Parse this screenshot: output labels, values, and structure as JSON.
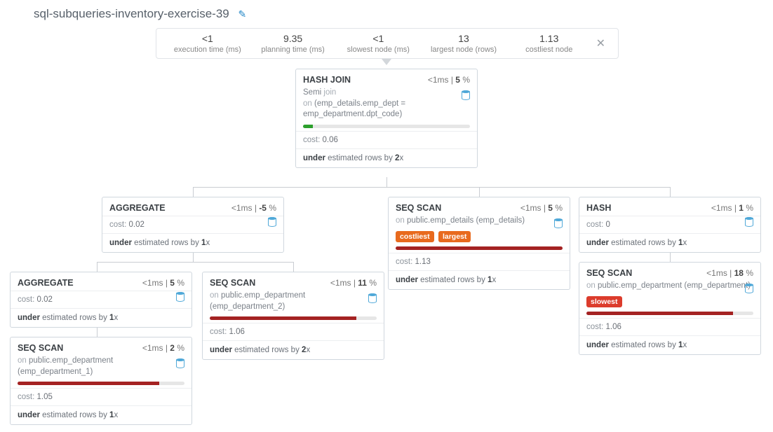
{
  "title": "sql-subqueries-inventory-exercise-39",
  "stats": [
    {
      "value": "<1",
      "label": "execution time (ms)"
    },
    {
      "value": "9.35",
      "label": "planning time (ms)"
    },
    {
      "value": "<1",
      "label": "slowest node (ms)"
    },
    {
      "value": "13",
      "label": "largest node (rows)"
    },
    {
      "value": "1.13",
      "label": "costliest node"
    }
  ],
  "nodes": {
    "hash_join": {
      "title": "HASH JOIN",
      "time": "<1",
      "pct": "5",
      "sub_a": "Semi",
      "sub_b": "join",
      "sub_c": "on",
      "sub_d": "(emp_details.emp_dept = emp_department.dpt_code)",
      "cost": "0.06",
      "est_prefix": "under",
      "est_mid": "estimated rows by",
      "est_x": "2"
    },
    "agg1": {
      "title": "AGGREGATE",
      "time": "<1",
      "pct": "-5",
      "cost": "0.02",
      "est_prefix": "under",
      "est_mid": "estimated rows by",
      "est_x": "1"
    },
    "agg2": {
      "title": "AGGREGATE",
      "time": "<1",
      "pct": "5",
      "cost": "0.02",
      "est_prefix": "under",
      "est_mid": "estimated rows by",
      "est_x": "1"
    },
    "seqscan_dep1": {
      "title": "SEQ SCAN",
      "time": "<1",
      "pct": "2",
      "on_pre": "on",
      "on": "public.emp_department (emp_department_1)",
      "cost": "1.05",
      "est_prefix": "under",
      "est_mid": "estimated rows by",
      "est_x": "1"
    },
    "seqscan_dep2": {
      "title": "SEQ SCAN",
      "time": "<1",
      "pct": "11",
      "on_pre": "on",
      "on": "public.emp_department (emp_department_2)",
      "cost": "1.06",
      "est_prefix": "under",
      "est_mid": "estimated rows by",
      "est_x": "2"
    },
    "seqscan_details": {
      "title": "SEQ SCAN",
      "time": "<1",
      "pct": "5",
      "on_pre": "on",
      "on": "public.emp_details (emp_details)",
      "tag_cost": "costliest",
      "tag_large": "largest",
      "cost": "1.13",
      "est_prefix": "under",
      "est_mid": "estimated rows by",
      "est_x": "1"
    },
    "hash": {
      "title": "HASH",
      "time": "<1",
      "pct": "1",
      "cost": "0",
      "est_prefix": "under",
      "est_mid": "estimated rows by",
      "est_x": "1"
    },
    "seqscan_dep": {
      "title": "SEQ SCAN",
      "time": "<1",
      "pct": "18",
      "on_pre": "on",
      "on": "public.emp_department (emp_department)",
      "tag_slow": "slowest",
      "cost": "1.06",
      "est_prefix": "under",
      "est_mid": "estimated rows by",
      "est_x": "1"
    }
  },
  "labels": {
    "cost": "cost:",
    "x_suffix": "x",
    "ms": "ms",
    "pct": "%"
  }
}
